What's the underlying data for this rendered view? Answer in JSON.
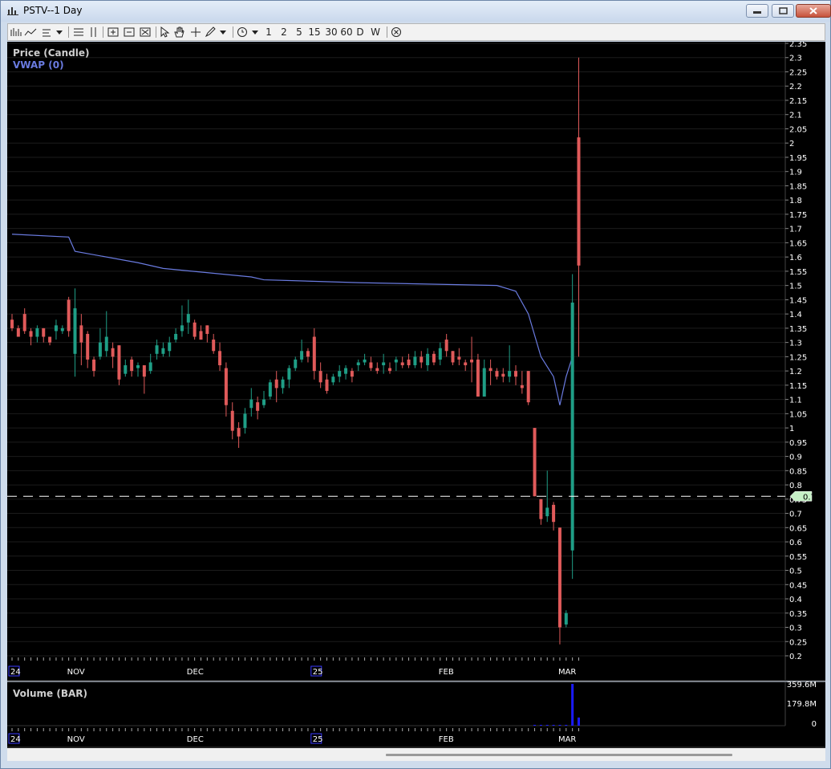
{
  "window": {
    "title": "PSTV--1 Day"
  },
  "toolbar": {
    "intervals": [
      "1",
      "2",
      "5",
      "15",
      "30",
      "60",
      "D",
      "W"
    ]
  },
  "panes": {
    "price_label": "Price (Candle)",
    "vwap_label": "VWAP (0)",
    "volume_label": "Volume (BAR)"
  },
  "price_axis": {
    "ticks": [
      "2.35",
      "2.3",
      "2.25",
      "2.2",
      "2.15",
      "2.1",
      "2.05",
      "2",
      "1.95",
      "1.9",
      "1.85",
      "1.8",
      "1.75",
      "1.7",
      "1.65",
      "1.6",
      "1.55",
      "1.5",
      "1.45",
      "1.4",
      "1.35",
      "1.3",
      "1.25",
      "1.2",
      "1.15",
      "1.1",
      "1.05",
      "1",
      "0.95",
      "0.9",
      "0.85",
      "0.8",
      "0.75",
      "0.7",
      "0.65",
      "0.6",
      "0.55",
      "0.5",
      "0.45",
      "0.4",
      "0.35",
      "0.3",
      "0.25",
      "0.2"
    ],
    "crosshair_value": "0.76"
  },
  "volume_axis": {
    "ticks": [
      "359.6M",
      "179.8M",
      "0"
    ]
  },
  "time_axis": {
    "labels": [
      {
        "text": "24",
        "boxed": true,
        "i": 0
      },
      {
        "text": "NOV",
        "boxed": false,
        "i": 9
      },
      {
        "text": "DEC",
        "boxed": false,
        "i": 28
      },
      {
        "text": "25",
        "boxed": true,
        "i": 48
      },
      {
        "text": "FEB",
        "boxed": false,
        "i": 68
      },
      {
        "text": "MAR",
        "boxed": false,
        "i": 87
      }
    ]
  },
  "colors": {
    "up": "#1f9e86",
    "down": "#e05a5a",
    "vwap": "#6a7be0",
    "volume": "#1a1aff",
    "axis_text": "#ffffff"
  },
  "chart_data": {
    "type": "candlestick",
    "price_range": [
      0.2,
      2.35
    ],
    "volume_range": [
      0,
      359600000
    ],
    "crosshair_price": 0.76,
    "candles": [
      {
        "o": 1.38,
        "h": 1.4,
        "c": 1.35,
        "l": 1.34
      },
      {
        "o": 1.35,
        "h": 1.36,
        "c": 1.32,
        "l": 1.32
      },
      {
        "o": 1.4,
        "h": 1.42,
        "c": 1.34,
        "l": 1.33
      },
      {
        "o": 1.34,
        "h": 1.35,
        "c": 1.32,
        "l": 1.29
      },
      {
        "o": 1.32,
        "h": 1.36,
        "c": 1.35,
        "l": 1.3
      },
      {
        "o": 1.35,
        "h": 1.35,
        "c": 1.32,
        "l": 1.3
      },
      {
        "o": 1.32,
        "h": 1.32,
        "c": 1.3,
        "l": 1.29
      },
      {
        "o": 1.34,
        "h": 1.38,
        "c": 1.36,
        "l": 1.31
      },
      {
        "o": 1.34,
        "h": 1.36,
        "c": 1.35,
        "l": 1.33
      },
      {
        "o": 1.45,
        "h": 1.46,
        "c": 1.34,
        "l": 1.32
      },
      {
        "o": 1.26,
        "h": 1.49,
        "c": 1.42,
        "l": 1.18
      },
      {
        "o": 1.36,
        "h": 1.4,
        "c": 1.3,
        "l": 1.22
      },
      {
        "o": 1.33,
        "h": 1.34,
        "c": 1.24,
        "l": 1.21
      },
      {
        "o": 1.24,
        "h": 1.25,
        "c": 1.2,
        "l": 1.18
      },
      {
        "o": 1.25,
        "h": 1.35,
        "c": 1.3,
        "l": 1.24
      },
      {
        "o": 1.27,
        "h": 1.41,
        "c": 1.32,
        "l": 1.25
      },
      {
        "o": 1.28,
        "h": 1.3,
        "c": 1.25,
        "l": 1.21
      },
      {
        "o": 1.29,
        "h": 1.29,
        "c": 1.17,
        "l": 1.15
      },
      {
        "o": 1.19,
        "h": 1.24,
        "c": 1.22,
        "l": 1.18
      },
      {
        "o": 1.24,
        "h": 1.25,
        "c": 1.2,
        "l": 1.18
      },
      {
        "o": 1.21,
        "h": 1.23,
        "c": 1.22,
        "l": 1.18
      },
      {
        "o": 1.22,
        "h": 1.22,
        "c": 1.18,
        "l": 1.12
      },
      {
        "o": 1.2,
        "h": 1.26,
        "c": 1.23,
        "l": 1.19
      },
      {
        "o": 1.26,
        "h": 1.31,
        "c": 1.29,
        "l": 1.24
      },
      {
        "o": 1.26,
        "h": 1.3,
        "c": 1.28,
        "l": 1.25
      },
      {
        "o": 1.27,
        "h": 1.32,
        "c": 1.3,
        "l": 1.25
      },
      {
        "o": 1.31,
        "h": 1.35,
        "c": 1.33,
        "l": 1.3
      },
      {
        "o": 1.34,
        "h": 1.43,
        "c": 1.36,
        "l": 1.32
      },
      {
        "o": 1.37,
        "h": 1.45,
        "c": 1.4,
        "l": 1.33
      },
      {
        "o": 1.37,
        "h": 1.38,
        "c": 1.32,
        "l": 1.31
      },
      {
        "o": 1.34,
        "h": 1.36,
        "c": 1.31,
        "l": 1.31
      },
      {
        "o": 1.36,
        "h": 1.36,
        "c": 1.33,
        "l": 1.3
      },
      {
        "o": 1.31,
        "h": 1.33,
        "c": 1.27,
        "l": 1.26
      },
      {
        "o": 1.27,
        "h": 1.3,
        "c": 1.22,
        "l": 1.2
      },
      {
        "o": 1.21,
        "h": 1.23,
        "c": 1.08,
        "l": 1.04
      },
      {
        "o": 1.06,
        "h": 1.09,
        "c": 0.99,
        "l": 0.96
      },
      {
        "o": 1.0,
        "h": 1.02,
        "c": 0.97,
        "l": 0.93
      },
      {
        "o": 1.0,
        "h": 1.07,
        "c": 1.05,
        "l": 0.98
      },
      {
        "o": 1.07,
        "h": 1.14,
        "c": 1.1,
        "l": 1.04
      },
      {
        "o": 1.09,
        "h": 1.11,
        "c": 1.06,
        "l": 1.03
      },
      {
        "o": 1.08,
        "h": 1.13,
        "c": 1.1,
        "l": 1.07
      },
      {
        "o": 1.11,
        "h": 1.17,
        "c": 1.16,
        "l": 1.1
      },
      {
        "o": 1.17,
        "h": 1.2,
        "c": 1.14,
        "l": 1.09
      },
      {
        "o": 1.14,
        "h": 1.18,
        "c": 1.17,
        "l": 1.12
      },
      {
        "o": 1.17,
        "h": 1.22,
        "c": 1.21,
        "l": 1.14
      },
      {
        "o": 1.21,
        "h": 1.25,
        "c": 1.24,
        "l": 1.2
      },
      {
        "o": 1.24,
        "h": 1.31,
        "c": 1.27,
        "l": 1.23
      },
      {
        "o": 1.27,
        "h": 1.28,
        "c": 1.25,
        "l": 1.23
      },
      {
        "o": 1.32,
        "h": 1.35,
        "c": 1.2,
        "l": 1.17
      },
      {
        "o": 1.2,
        "h": 1.23,
        "c": 1.16,
        "l": 1.14
      },
      {
        "o": 1.17,
        "h": 1.19,
        "c": 1.13,
        "l": 1.12
      },
      {
        "o": 1.16,
        "h": 1.19,
        "c": 1.18,
        "l": 1.15
      },
      {
        "o": 1.18,
        "h": 1.22,
        "c": 1.2,
        "l": 1.16
      },
      {
        "o": 1.19,
        "h": 1.22,
        "c": 1.21,
        "l": 1.17
      },
      {
        "o": 1.2,
        "h": 1.21,
        "c": 1.18,
        "l": 1.16
      },
      {
        "o": 1.22,
        "h": 1.24,
        "c": 1.23,
        "l": 1.2
      },
      {
        "o": 1.23,
        "h": 1.26,
        "c": 1.24,
        "l": 1.22
      },
      {
        "o": 1.23,
        "h": 1.25,
        "c": 1.21,
        "l": 1.2
      },
      {
        "o": 1.21,
        "h": 1.23,
        "c": 1.2,
        "l": 1.19
      },
      {
        "o": 1.22,
        "h": 1.26,
        "c": 1.23,
        "l": 1.19
      },
      {
        "o": 1.21,
        "h": 1.23,
        "c": 1.2,
        "l": 1.19
      },
      {
        "o": 1.23,
        "h": 1.25,
        "c": 1.24,
        "l": 1.2
      },
      {
        "o": 1.23,
        "h": 1.25,
        "c": 1.22,
        "l": 1.21
      },
      {
        "o": 1.24,
        "h": 1.26,
        "c": 1.22,
        "l": 1.21
      },
      {
        "o": 1.22,
        "h": 1.27,
        "c": 1.25,
        "l": 1.21
      },
      {
        "o": 1.25,
        "h": 1.27,
        "c": 1.23,
        "l": 1.21
      },
      {
        "o": 1.22,
        "h": 1.28,
        "c": 1.26,
        "l": 1.2
      },
      {
        "o": 1.26,
        "h": 1.27,
        "c": 1.23,
        "l": 1.22
      },
      {
        "o": 1.24,
        "h": 1.3,
        "c": 1.28,
        "l": 1.22
      },
      {
        "o": 1.31,
        "h": 1.33,
        "c": 1.27,
        "l": 1.25
      },
      {
        "o": 1.27,
        "h": 1.27,
        "c": 1.23,
        "l": 1.22
      },
      {
        "o": 1.25,
        "h": 1.28,
        "c": 1.24,
        "l": 1.22
      },
      {
        "o": 1.23,
        "h": 1.24,
        "c": 1.22,
        "l": 1.2
      },
      {
        "o": 1.24,
        "h": 1.32,
        "c": 1.23,
        "l": 1.16
      },
      {
        "o": 1.24,
        "h": 1.26,
        "c": 1.11,
        "l": 1.11
      },
      {
        "o": 1.11,
        "h": 1.24,
        "c": 1.21,
        "l": 1.11
      },
      {
        "o": 1.21,
        "h": 1.24,
        "c": 1.2,
        "l": 1.15
      },
      {
        "o": 1.2,
        "h": 1.21,
        "c": 1.18,
        "l": 1.17
      },
      {
        "o": 1.19,
        "h": 1.21,
        "c": 1.18,
        "l": 1.16
      },
      {
        "o": 1.18,
        "h": 1.29,
        "c": 1.2,
        "l": 1.16
      },
      {
        "o": 1.2,
        "h": 1.22,
        "c": 1.18,
        "l": 1.15
      },
      {
        "o": 1.15,
        "h": 1.2,
        "c": 1.14,
        "l": 1.12
      },
      {
        "o": 1.2,
        "h": 1.2,
        "c": 1.09,
        "l": 1.08
      },
      {
        "o": 1.0,
        "h": 1.0,
        "c": 0.76,
        "l": 0.76
      },
      {
        "o": 0.75,
        "h": 0.75,
        "c": 0.68,
        "l": 0.66
      },
      {
        "o": 0.69,
        "h": 0.85,
        "c": 0.72,
        "l": 0.67
      },
      {
        "o": 0.73,
        "h": 0.74,
        "c": 0.67,
        "l": 0.64
      },
      {
        "o": 0.65,
        "h": 0.65,
        "c": 0.3,
        "l": 0.24
      },
      {
        "o": 0.31,
        "h": 0.36,
        "c": 0.35,
        "l": 0.3
      },
      {
        "o": 0.57,
        "h": 1.54,
        "c": 1.44,
        "l": 0.47
      },
      {
        "o": 2.02,
        "h": 2.3,
        "c": 1.57,
        "l": 1.25
      }
    ],
    "volume": [
      0,
      0,
      0,
      0,
      0,
      0,
      0,
      0,
      0,
      0,
      0,
      0,
      0,
      0,
      0,
      0,
      0,
      0,
      0,
      0,
      0,
      0,
      0,
      0,
      0,
      0,
      0,
      0,
      0,
      0,
      0,
      0,
      0,
      0,
      0,
      0,
      0,
      0,
      0,
      0,
      0,
      0,
      0,
      0,
      0,
      0,
      0,
      0,
      0,
      0,
      0,
      0,
      0,
      0,
      0,
      0,
      0,
      0,
      0,
      0,
      0,
      0,
      0,
      0,
      0,
      0,
      0,
      0,
      0,
      0,
      0,
      0,
      0,
      0,
      0,
      0,
      0,
      0,
      0,
      0,
      0,
      0,
      0,
      3000000,
      2500000,
      2000000,
      1500000,
      4000000,
      3000000,
      359600000,
      70000000
    ],
    "vwap": [
      [
        0,
        1.68
      ],
      [
        9,
        1.67
      ],
      [
        10,
        1.62
      ],
      [
        20,
        1.58
      ],
      [
        24,
        1.56
      ],
      [
        38,
        1.53
      ],
      [
        40,
        1.52
      ],
      [
        55,
        1.51
      ],
      [
        77,
        1.5
      ],
      [
        80,
        1.48
      ],
      [
        82,
        1.4
      ],
      [
        84,
        1.25
      ],
      [
        86,
        1.18
      ],
      [
        87,
        1.08
      ],
      [
        88,
        1.18
      ],
      [
        89,
        1.25
      ]
    ]
  }
}
